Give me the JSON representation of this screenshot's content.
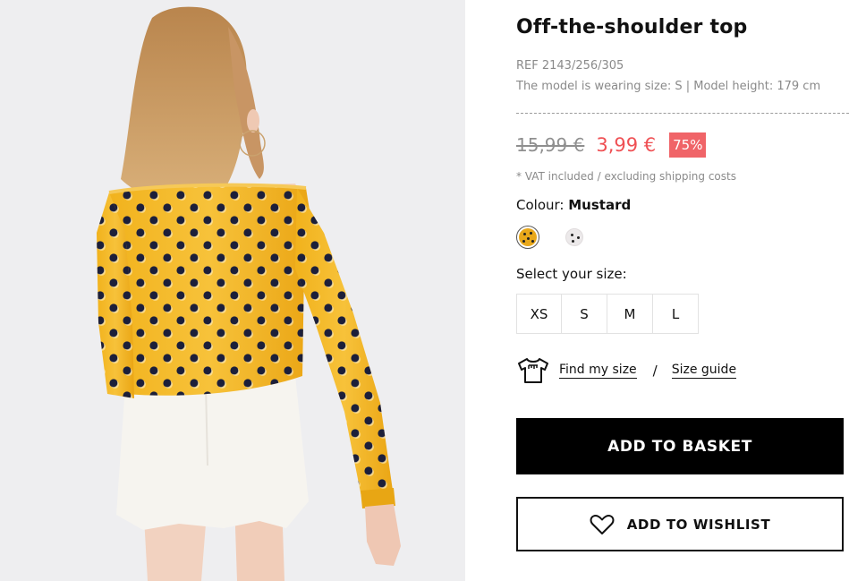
{
  "product": {
    "image_alt": "Back view of model wearing a mustard off-the-shoulder top with navy polka dots and a white denim skirt",
    "title": "Off-the-shoulder top",
    "ref": "REF 2143/256/305",
    "model_info": "The model is wearing size: S | Model height: 179 cm",
    "old_price": "15,99 €",
    "new_price": "3,99 €",
    "discount": "75%",
    "vat_note": "* VAT included / excluding shipping costs",
    "colour_label": "Colour:",
    "colour_value": "Mustard",
    "swatches": [
      {
        "name": "Mustard",
        "color": "#e9a81a",
        "selected": true
      },
      {
        "name": "Light grey",
        "color": "#ece9ea",
        "selected": false
      }
    ],
    "size_label": "Select your size:",
    "sizes": [
      "XS",
      "S",
      "M",
      "L"
    ],
    "find_size": "Find my size",
    "separator": "/",
    "size_guide": "Size guide",
    "add_to_basket": "ADD TO BASKET",
    "add_to_wishlist": "ADD TO WISHLIST",
    "icons": [
      "tshirt-icon",
      "heart-icon"
    ],
    "accent_color": "#ef5054",
    "badge_color": "#f06468"
  }
}
